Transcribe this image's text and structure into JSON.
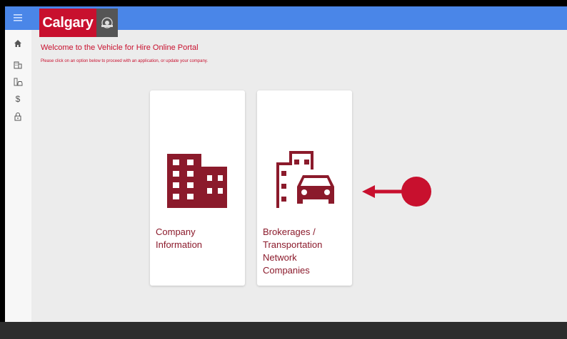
{
  "brand": {
    "name": "Calgary",
    "red": "#c8102e",
    "dark_red": "#8b1a2b",
    "topbar_color": "#4a86e8"
  },
  "page": {
    "title": "Welcome to the Vehicle for Hire Online Portal",
    "subtitle": "Please click on an option below to proceed with an application, or update your company."
  },
  "sidebar": {
    "items": [
      {
        "name": "menu-icon"
      },
      {
        "name": "home-icon"
      },
      {
        "name": "building-icon"
      },
      {
        "name": "city-car-icon"
      },
      {
        "name": "dollar-icon",
        "glyph": "$"
      },
      {
        "name": "lock-icon"
      }
    ]
  },
  "cards": [
    {
      "label_line1": "Company",
      "label_line2": "Information",
      "icon": "building-icon"
    },
    {
      "label_line1": "Brokerages /",
      "label_line2": "Transportation",
      "label_line3": "Network",
      "label_line4": "Companies",
      "icon": "city-car-icon"
    }
  ],
  "annotation": {
    "type": "arrow-pointer-icon",
    "color": "#c8102e"
  }
}
